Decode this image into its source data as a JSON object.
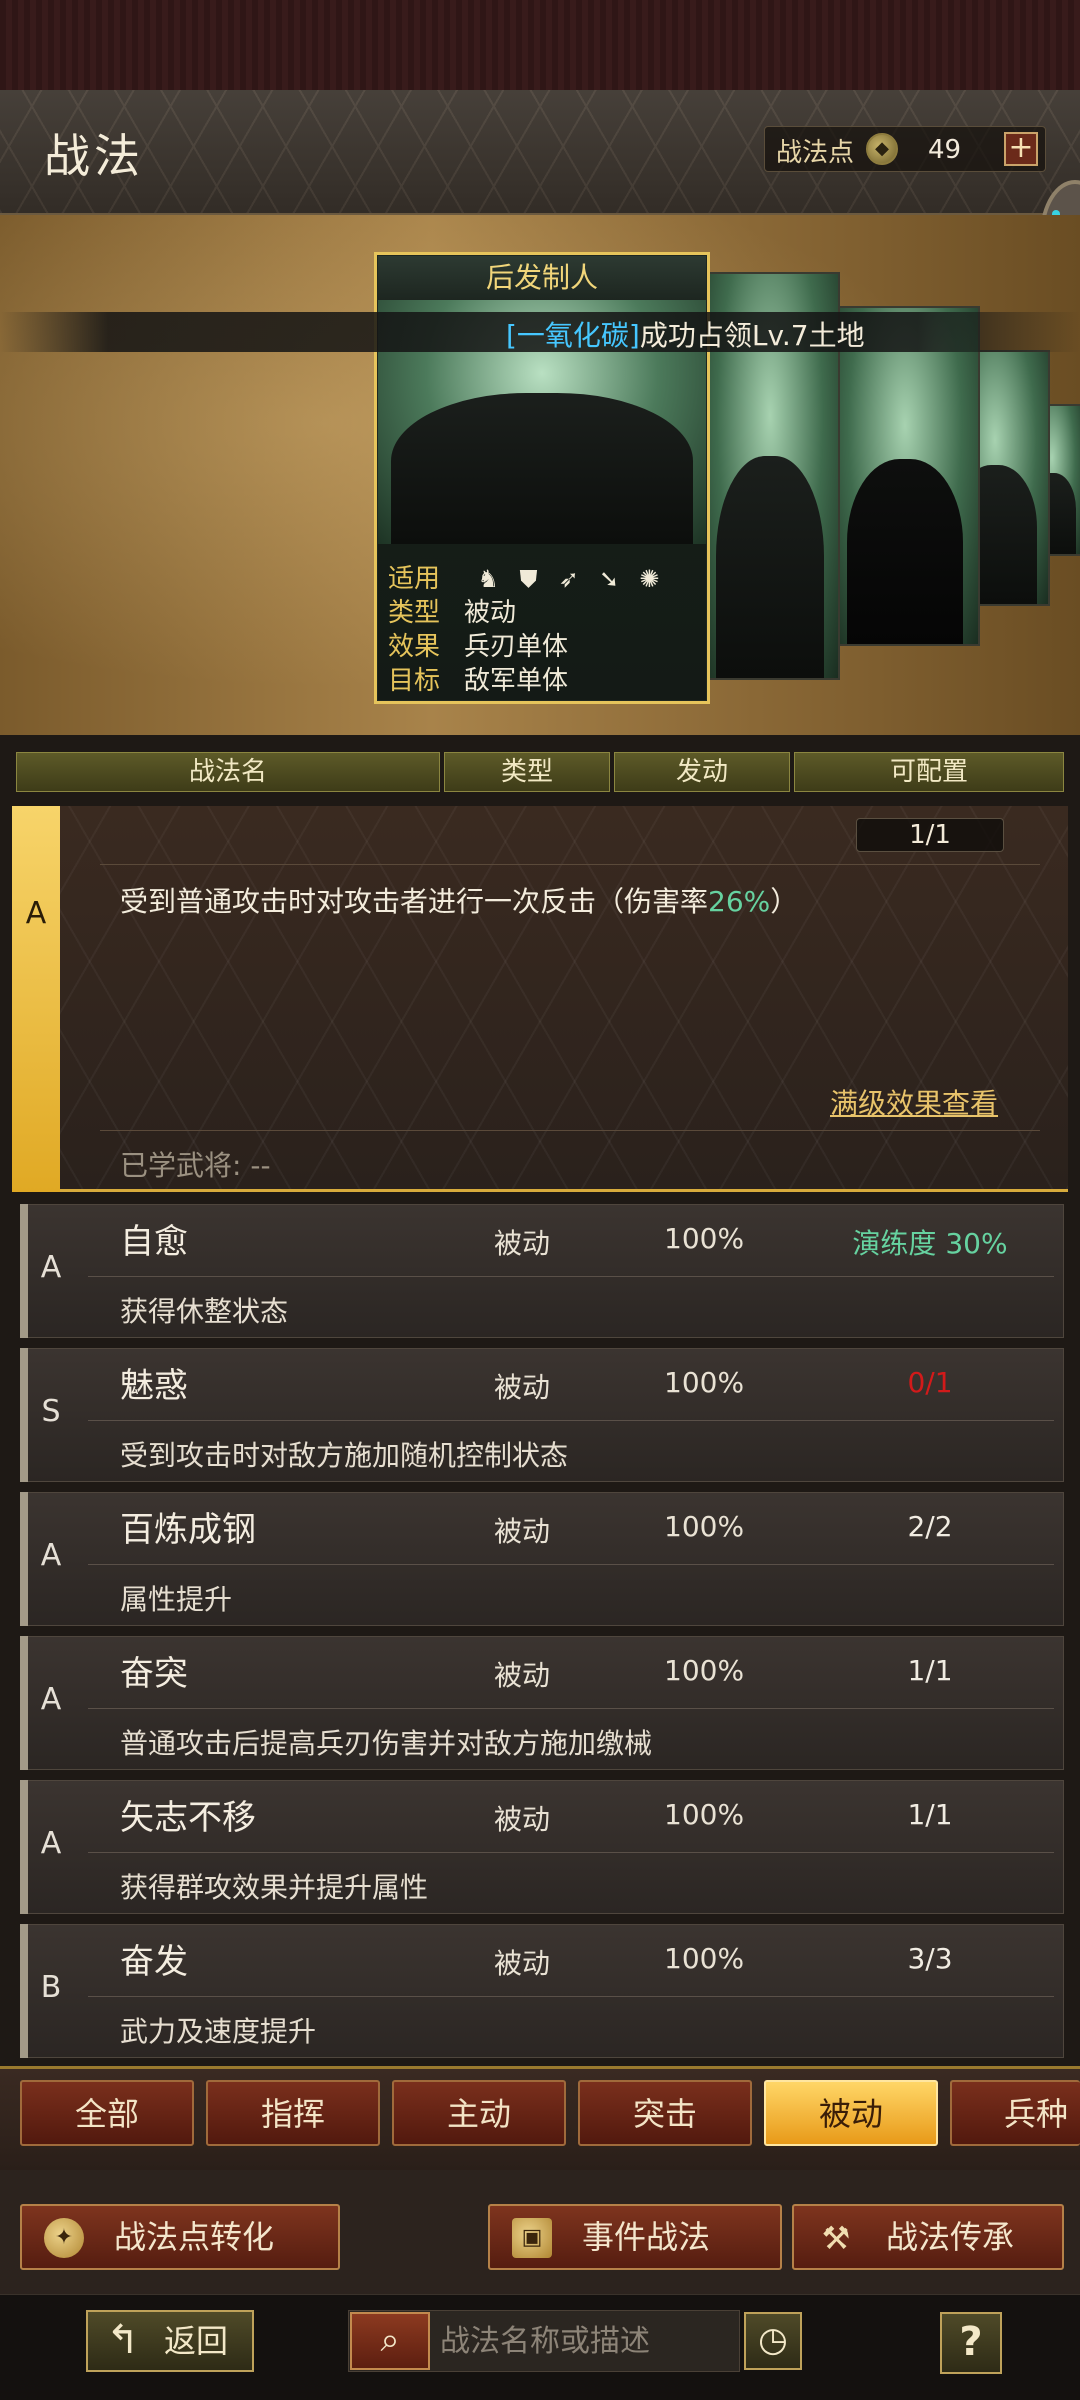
{
  "header": {
    "title": "战法",
    "points_label": "战法点",
    "points_value": "49",
    "plus_label": "+"
  },
  "showcase": {
    "main_card": {
      "title": "后发制人",
      "info": [
        {
          "key": "适用",
          "value": ""
        },
        {
          "key": "类型",
          "value": "被动"
        },
        {
          "key": "效果",
          "value": "兵刃单体"
        },
        {
          "key": "目标",
          "value": "敌军单体"
        }
      ],
      "troop_icons": [
        "cavalry-icon",
        "shield-icon",
        "bow-icon",
        "spear-icon",
        "chariot-icon"
      ]
    },
    "banner": {
      "highlight": "[一氧化碳]",
      "text": "成功占领Lv.7土地"
    }
  },
  "table_header": {
    "name": "战法名",
    "type": "类型",
    "trigger": "发动",
    "configurable": "可配置"
  },
  "expanded": {
    "rank": "A",
    "count": "1/1",
    "description_prefix": "受到普通攻击时对攻击者进行一次反击（伤害率",
    "description_pct": "26%",
    "description_suffix": "）",
    "max_level_link": "满级效果查看",
    "learned": "已学武将: --"
  },
  "rows": [
    {
      "rank": "A",
      "name": "自愈",
      "type": "被动",
      "rate": "100%",
      "status": "演练度 30%",
      "desc": "获得休整状态"
    },
    {
      "rank": "S",
      "name": "魅惑",
      "type": "被动",
      "rate": "100%",
      "status": "0/1",
      "desc": "受到攻击时对敌方施加随机控制状态"
    },
    {
      "rank": "A",
      "name": "百炼成钢",
      "type": "被动",
      "rate": "100%",
      "status": "2/2",
      "desc": "属性提升"
    },
    {
      "rank": "A",
      "name": "奋突",
      "type": "被动",
      "rate": "100%",
      "status": "1/1",
      "desc": "普通攻击后提高兵刃伤害并对敌方施加缴械"
    },
    {
      "rank": "A",
      "name": "矢志不移",
      "type": "被动",
      "rate": "100%",
      "status": "1/1",
      "desc": "获得群攻效果并提升属性"
    },
    {
      "rank": "B",
      "name": "奋发",
      "type": "被动",
      "rate": "100%",
      "status": "3/3",
      "desc": "武力及速度提升"
    }
  ],
  "filter_tabs": [
    "全部",
    "指挥",
    "主动",
    "突击",
    "被动",
    "兵种"
  ],
  "active_tab": "被动",
  "actions": {
    "convert": "战法点转化",
    "event": "事件战法",
    "inherit": "战法传承"
  },
  "footer": {
    "back": "返回",
    "search_placeholder": "战法名称或描述",
    "help": "?"
  },
  "colors": {
    "accent_gold": "#e6c45b",
    "active_tab": "#ffd667",
    "practice_green": "#66d2a0",
    "warning_red": "#d21a1a",
    "highlight_cyan": "#46c7ff"
  }
}
